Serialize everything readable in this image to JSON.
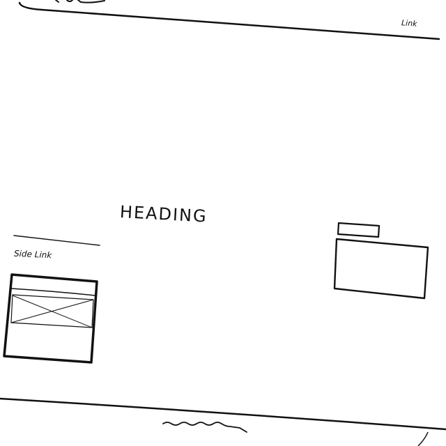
{
  "header": {
    "link_label": "Link"
  },
  "main": {
    "heading": "HEADING"
  },
  "sidebar": {
    "link_label": "Side Link"
  },
  "colors": {
    "ink": "#111111",
    "paper": "#ffffff",
    "background": "#000000"
  }
}
